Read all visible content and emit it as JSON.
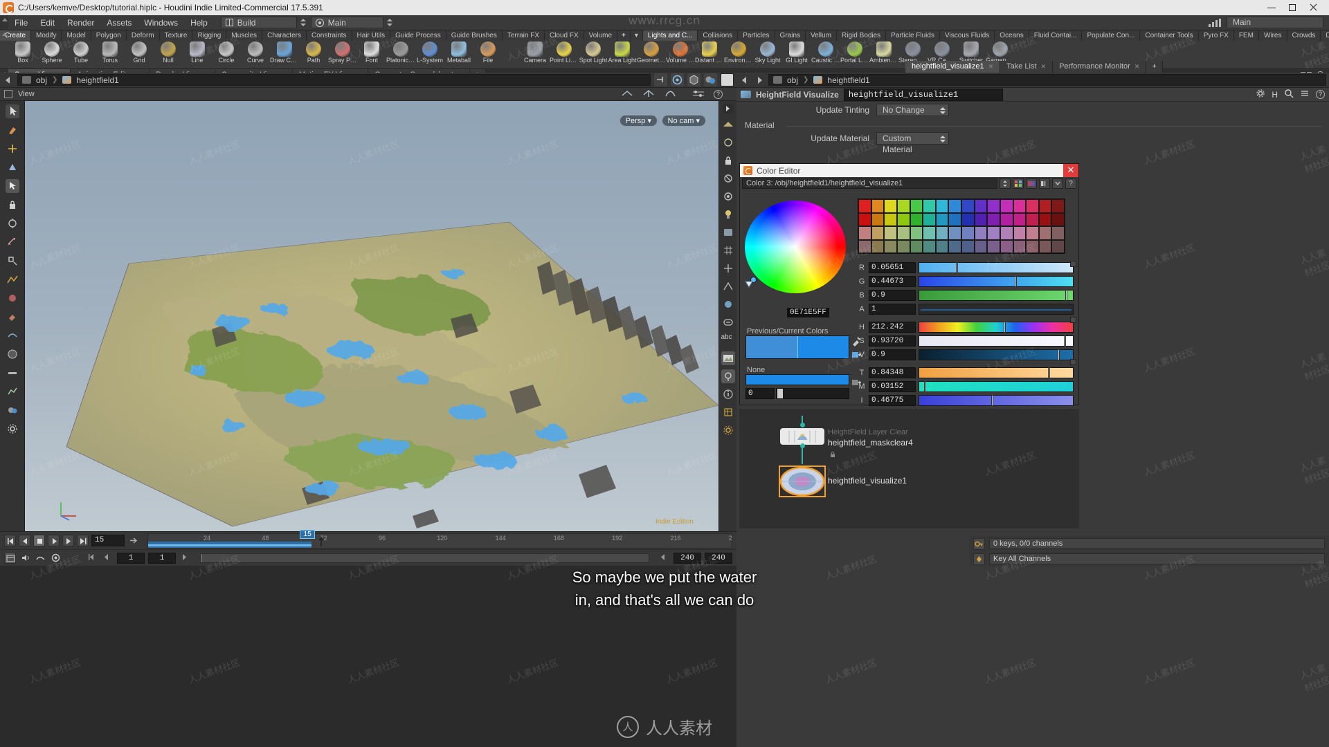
{
  "window": {
    "title": "C:/Users/kemve/Desktop/tutorial.hiplc - Houdini Indie Limited-Commercial 17.5.391",
    "logo": "houdini-logo",
    "minimize": "minimize-button",
    "maximize": "maximize-button",
    "close": "close-button"
  },
  "menubar": {
    "items": [
      "File",
      "Edit",
      "Render",
      "Assets",
      "Windows",
      "Help"
    ],
    "desktop_label": "Build",
    "main_label": "Main",
    "right_main_label": "Main"
  },
  "shelf": {
    "tabs_left": [
      "Create",
      "Modify",
      "Model",
      "Polygon",
      "Deform",
      "Texture",
      "Rigging",
      "Muscles",
      "Characters",
      "Constraints",
      "Hair Utils",
      "Guide Process",
      "Guide Brushes",
      "Terrain FX",
      "Cloud FX",
      "Volume"
    ],
    "active_left": "Create",
    "add_label": "+",
    "tabs_right": [
      "Lights and C...",
      "Collisions",
      "Particles",
      "Grains",
      "Vellum",
      "Rigid Bodies",
      "Particle Fluids",
      "Viscous Fluids",
      "Oceans",
      "Fluid Contai...",
      "Populate Con...",
      "Container Tools",
      "Pyro FX",
      "FEM",
      "Wires",
      "Crowds",
      "Drive Simula..."
    ],
    "active_right": "Lights and C...",
    "tools_left": [
      {
        "label": "Box",
        "color": "#c9c9c9"
      },
      {
        "label": "Sphere",
        "color": "#d9d9d9"
      },
      {
        "label": "Tube",
        "color": "#cfcfcf"
      },
      {
        "label": "Torus",
        "color": "#b9b9b9"
      },
      {
        "label": "Grid",
        "color": "#c2c2c2"
      },
      {
        "label": "Null",
        "color": "#c2a44a"
      },
      {
        "label": "Line",
        "color": "#b8b8c8"
      },
      {
        "label": "Circle",
        "color": "#c8c8c8"
      },
      {
        "label": "Curve",
        "color": "#bcbcbc"
      },
      {
        "label": "Draw Curve",
        "color": "#6aa5d8"
      },
      {
        "label": "Path",
        "color": "#d8b84a"
      },
      {
        "label": "Spray Paint",
        "color": "#d07070"
      },
      {
        "label": "Font",
        "color": "#dddddd"
      },
      {
        "label": "Platonic Solids",
        "color": "#9a9a9a"
      },
      {
        "label": "L-System",
        "color": "#5f8fd0"
      },
      {
        "label": "Metaball",
        "color": "#8fbfe0"
      },
      {
        "label": "File",
        "color": "#d89a5a"
      }
    ],
    "tools_right": [
      {
        "label": "Camera",
        "color": "#9aa0a8"
      },
      {
        "label": "Point Light",
        "color": "#e8d24a"
      },
      {
        "label": "Spot Light",
        "color": "#d8c890"
      },
      {
        "label": "Area Light",
        "color": "#c8d84a"
      },
      {
        "label": "Geometry Light",
        "color": "#d8a040"
      },
      {
        "label": "Volume Light",
        "color": "#e07030"
      },
      {
        "label": "Distant Light",
        "color": "#e8d050"
      },
      {
        "label": "Environment Light",
        "color": "#d8a830"
      },
      {
        "label": "Sky Light",
        "color": "#9ab8d8"
      },
      {
        "label": "GI Light",
        "color": "#dddddd"
      },
      {
        "label": "Caustic Light",
        "color": "#7ab0d8"
      },
      {
        "label": "Portal Light",
        "color": "#9ac84a"
      },
      {
        "label": "Ambient Light",
        "color": "#d8d8a0"
      },
      {
        "label": "Stereo Camera",
        "color": "#8a90a0"
      },
      {
        "label": "VR Camera",
        "color": "#8a90a0"
      },
      {
        "label": "Switcher",
        "color": "#a8a8b0"
      },
      {
        "label": "Gamepad Camera",
        "color": "#9aa0a8"
      }
    ]
  },
  "pane_tabs": {
    "items": [
      "Scene View",
      "Animation Editor",
      "Render View",
      "Composite View",
      "Motion FX View",
      "Geometry Spreadsheet"
    ],
    "active": "Scene View",
    "add_label": "+"
  },
  "path_bar": {
    "back_icon": "back-arrow-icon",
    "forward_icon": "forward-arrow-icon",
    "crumb_root": "obj",
    "crumb_node": "heightfield1"
  },
  "viewport": {
    "label": "View",
    "persp_label": "Persp",
    "cam_label": "No cam",
    "indie_watermark": "Indie Edition"
  },
  "playbar": {
    "current_frame": "15",
    "playhead_label": "15",
    "ticks": [
      "24",
      "48",
      "72",
      "96",
      "120",
      "144",
      "168",
      "192",
      "216",
      "2"
    ],
    "start_frame": "1",
    "start_frame2": "1",
    "end_frame": "240",
    "end_frame2": "240"
  },
  "right_tabs": {
    "items": [
      "heightfield_visualize1",
      "Take List",
      "Performance Monitor"
    ],
    "active": "heightfield_visualize1",
    "add_label": "+"
  },
  "parameters": {
    "node_type": "HeightField Visualize",
    "node_name": "heightfield_visualize1",
    "rows": [
      {
        "label": "Update Tinting",
        "value": "No Change"
      }
    ],
    "section_material": "Material",
    "material_rows": [
      {
        "label": "Update Material",
        "value": "Custom Material"
      }
    ]
  },
  "color_editor": {
    "title": "Color Editor",
    "close_label": "✕",
    "path": "Color 3: /obj/heightfield1/heightfield_visualize1",
    "hex": "0E71E5FF",
    "previous_current_label": "Previous/Current Colors",
    "none_label": "None",
    "none_value": "0",
    "channels": [
      {
        "name": "R",
        "value": "0.05651"
      },
      {
        "name": "G",
        "value": "0.44673"
      },
      {
        "name": "B",
        "value": "0.9"
      },
      {
        "name": "A",
        "value": "1"
      },
      {
        "name": "H",
        "value": "212.242"
      },
      {
        "name": "S",
        "value": "0.93720"
      },
      {
        "name": "V",
        "value": "0.9"
      },
      {
        "name": "T",
        "value": "0.84348"
      },
      {
        "name": "M",
        "value": "0.03152"
      },
      {
        "name": "I",
        "value": "0.46775"
      }
    ],
    "swatch_rows": [
      [
        "#e02020",
        "#e08820",
        "#e0d820",
        "#a8d820",
        "#48c848",
        "#30c8a8",
        "#30b8d8",
        "#3088d8",
        "#3048c8",
        "#6030c8",
        "#9030c8",
        "#c030b8",
        "#d83098",
        "#d83060",
        "#b02020",
        "#801818"
      ],
      [
        "#c81010",
        "#c87a10",
        "#c8c810",
        "#90c810",
        "#2fb02f",
        "#20b098",
        "#2098c0",
        "#2070c0",
        "#2030b0",
        "#5020b0",
        "#8020b0",
        "#b020a0",
        "#c02088",
        "#c02050",
        "#981010",
        "#6a1010"
      ],
      [
        "#c08080",
        "#c0a060",
        "#c0c080",
        "#a8c080",
        "#80c080",
        "#70c0b0",
        "#70b0c0",
        "#7090c0",
        "#7080c0",
        "#9080c0",
        "#a080c0",
        "#b080b8",
        "#c080a8",
        "#c08090",
        "#a07070",
        "#806060"
      ],
      [
        "#8a6a6a",
        "#8a7a50",
        "#8a8a60",
        "#7a8a60",
        "#608a60",
        "#508a80",
        "#50808a",
        "#506a8a",
        "#50608a",
        "#68608a",
        "#7a608a",
        "#8a6088",
        "#8a6078",
        "#8a6068",
        "#7a5858",
        "#604848"
      ]
    ]
  },
  "network": {
    "nodes": [
      {
        "type": "HeightField Layer Clear",
        "name": "heightfield_maskclear4",
        "selected": false
      },
      {
        "type": "",
        "name": "heightfield_visualize1",
        "selected": true
      }
    ]
  },
  "bottom_right": {
    "keys_label": "0 keys, 0/0 channels",
    "key_all_label": "Key All Channels"
  },
  "subtitles": {
    "line1": "So maybe we put the water",
    "line2": "in, and that's all we can do"
  },
  "watermarks": {
    "top": "www.rrcg.cn",
    "bottom": "人人素材",
    "tile": "人人素材社区"
  }
}
